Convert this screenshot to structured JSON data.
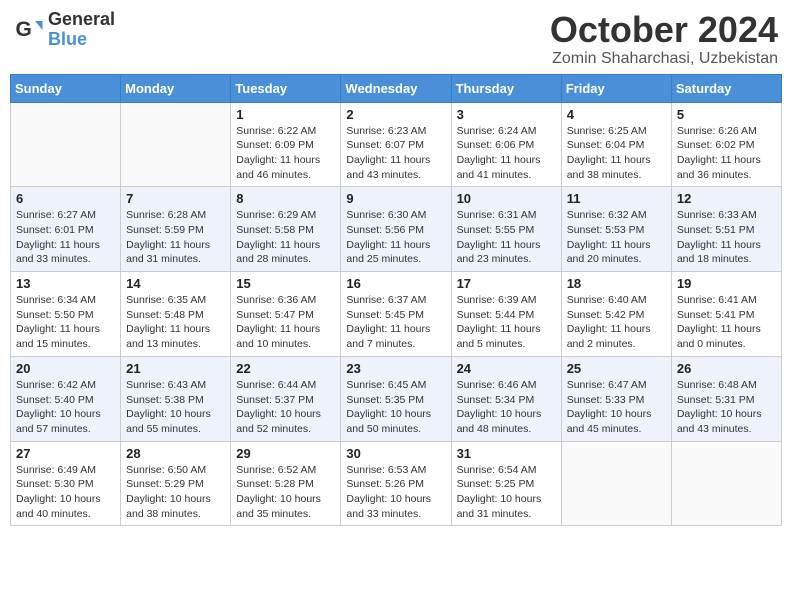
{
  "header": {
    "logo_general": "General",
    "logo_blue": "Blue",
    "month_title": "October 2024",
    "location": "Zomin Shaharchasi, Uzbekistan"
  },
  "days_of_week": [
    "Sunday",
    "Monday",
    "Tuesday",
    "Wednesday",
    "Thursday",
    "Friday",
    "Saturday"
  ],
  "weeks": [
    [
      {
        "day": "",
        "info": ""
      },
      {
        "day": "",
        "info": ""
      },
      {
        "day": "1",
        "info": "Sunrise: 6:22 AM\nSunset: 6:09 PM\nDaylight: 11 hours and 46 minutes."
      },
      {
        "day": "2",
        "info": "Sunrise: 6:23 AM\nSunset: 6:07 PM\nDaylight: 11 hours and 43 minutes."
      },
      {
        "day": "3",
        "info": "Sunrise: 6:24 AM\nSunset: 6:06 PM\nDaylight: 11 hours and 41 minutes."
      },
      {
        "day": "4",
        "info": "Sunrise: 6:25 AM\nSunset: 6:04 PM\nDaylight: 11 hours and 38 minutes."
      },
      {
        "day": "5",
        "info": "Sunrise: 6:26 AM\nSunset: 6:02 PM\nDaylight: 11 hours and 36 minutes."
      }
    ],
    [
      {
        "day": "6",
        "info": "Sunrise: 6:27 AM\nSunset: 6:01 PM\nDaylight: 11 hours and 33 minutes."
      },
      {
        "day": "7",
        "info": "Sunrise: 6:28 AM\nSunset: 5:59 PM\nDaylight: 11 hours and 31 minutes."
      },
      {
        "day": "8",
        "info": "Sunrise: 6:29 AM\nSunset: 5:58 PM\nDaylight: 11 hours and 28 minutes."
      },
      {
        "day": "9",
        "info": "Sunrise: 6:30 AM\nSunset: 5:56 PM\nDaylight: 11 hours and 25 minutes."
      },
      {
        "day": "10",
        "info": "Sunrise: 6:31 AM\nSunset: 5:55 PM\nDaylight: 11 hours and 23 minutes."
      },
      {
        "day": "11",
        "info": "Sunrise: 6:32 AM\nSunset: 5:53 PM\nDaylight: 11 hours and 20 minutes."
      },
      {
        "day": "12",
        "info": "Sunrise: 6:33 AM\nSunset: 5:51 PM\nDaylight: 11 hours and 18 minutes."
      }
    ],
    [
      {
        "day": "13",
        "info": "Sunrise: 6:34 AM\nSunset: 5:50 PM\nDaylight: 11 hours and 15 minutes."
      },
      {
        "day": "14",
        "info": "Sunrise: 6:35 AM\nSunset: 5:48 PM\nDaylight: 11 hours and 13 minutes."
      },
      {
        "day": "15",
        "info": "Sunrise: 6:36 AM\nSunset: 5:47 PM\nDaylight: 11 hours and 10 minutes."
      },
      {
        "day": "16",
        "info": "Sunrise: 6:37 AM\nSunset: 5:45 PM\nDaylight: 11 hours and 7 minutes."
      },
      {
        "day": "17",
        "info": "Sunrise: 6:39 AM\nSunset: 5:44 PM\nDaylight: 11 hours and 5 minutes."
      },
      {
        "day": "18",
        "info": "Sunrise: 6:40 AM\nSunset: 5:42 PM\nDaylight: 11 hours and 2 minutes."
      },
      {
        "day": "19",
        "info": "Sunrise: 6:41 AM\nSunset: 5:41 PM\nDaylight: 11 hours and 0 minutes."
      }
    ],
    [
      {
        "day": "20",
        "info": "Sunrise: 6:42 AM\nSunset: 5:40 PM\nDaylight: 10 hours and 57 minutes."
      },
      {
        "day": "21",
        "info": "Sunrise: 6:43 AM\nSunset: 5:38 PM\nDaylight: 10 hours and 55 minutes."
      },
      {
        "day": "22",
        "info": "Sunrise: 6:44 AM\nSunset: 5:37 PM\nDaylight: 10 hours and 52 minutes."
      },
      {
        "day": "23",
        "info": "Sunrise: 6:45 AM\nSunset: 5:35 PM\nDaylight: 10 hours and 50 minutes."
      },
      {
        "day": "24",
        "info": "Sunrise: 6:46 AM\nSunset: 5:34 PM\nDaylight: 10 hours and 48 minutes."
      },
      {
        "day": "25",
        "info": "Sunrise: 6:47 AM\nSunset: 5:33 PM\nDaylight: 10 hours and 45 minutes."
      },
      {
        "day": "26",
        "info": "Sunrise: 6:48 AM\nSunset: 5:31 PM\nDaylight: 10 hours and 43 minutes."
      }
    ],
    [
      {
        "day": "27",
        "info": "Sunrise: 6:49 AM\nSunset: 5:30 PM\nDaylight: 10 hours and 40 minutes."
      },
      {
        "day": "28",
        "info": "Sunrise: 6:50 AM\nSunset: 5:29 PM\nDaylight: 10 hours and 38 minutes."
      },
      {
        "day": "29",
        "info": "Sunrise: 6:52 AM\nSunset: 5:28 PM\nDaylight: 10 hours and 35 minutes."
      },
      {
        "day": "30",
        "info": "Sunrise: 6:53 AM\nSunset: 5:26 PM\nDaylight: 10 hours and 33 minutes."
      },
      {
        "day": "31",
        "info": "Sunrise: 6:54 AM\nSunset: 5:25 PM\nDaylight: 10 hours and 31 minutes."
      },
      {
        "day": "",
        "info": ""
      },
      {
        "day": "",
        "info": ""
      }
    ]
  ]
}
